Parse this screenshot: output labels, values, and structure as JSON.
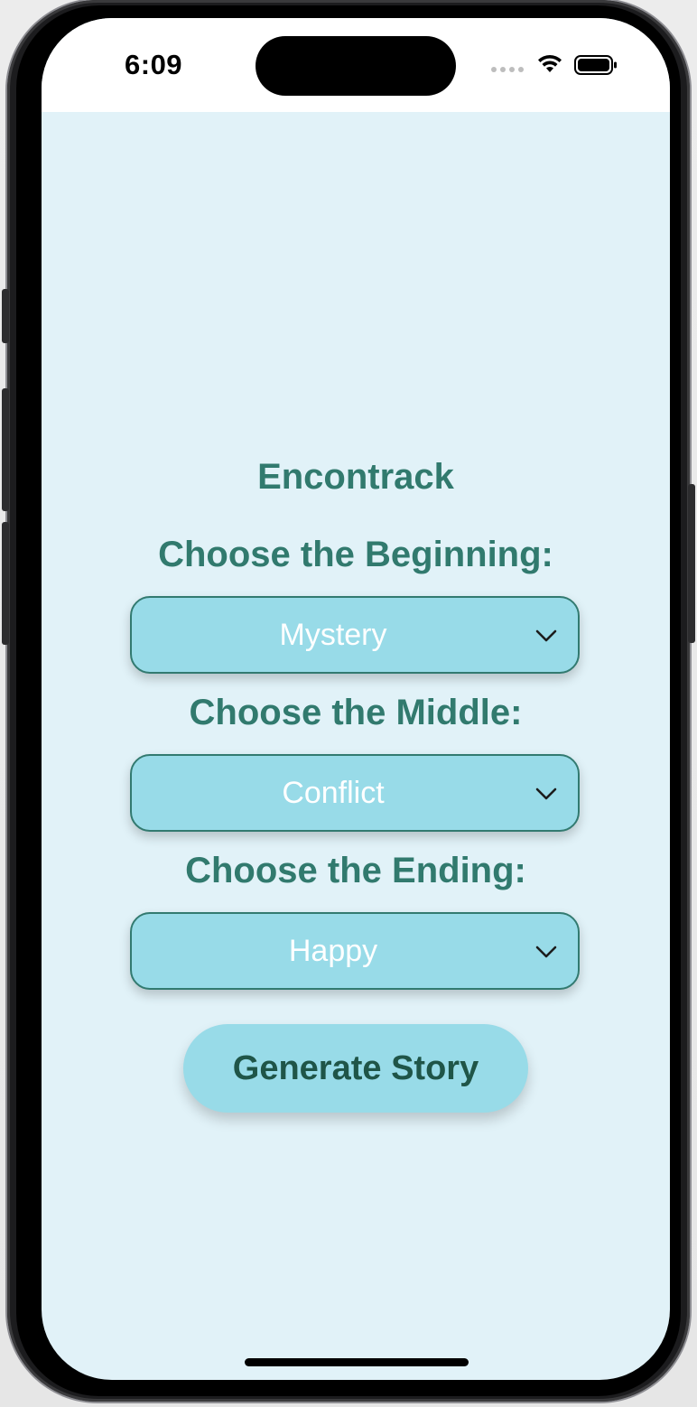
{
  "status_bar": {
    "time": "6:09"
  },
  "app": {
    "title": "Encontrack"
  },
  "sections": [
    {
      "label": "Choose the Beginning:",
      "selected": "Mystery"
    },
    {
      "label": "Choose the Middle:",
      "selected": "Conflict"
    },
    {
      "label": "Choose the Ending:",
      "selected": "Happy"
    }
  ],
  "actions": {
    "generate_label": "Generate Story"
  },
  "colors": {
    "background": "#e1f2f8",
    "accent_text": "#317a6e",
    "dropdown_fill": "#98dbe8",
    "dropdown_border": "#327a70",
    "button_text": "#1f5548"
  },
  "icons": {
    "wifi": "wifi-icon",
    "battery": "battery-icon",
    "chevron": "chevron-down-icon"
  }
}
